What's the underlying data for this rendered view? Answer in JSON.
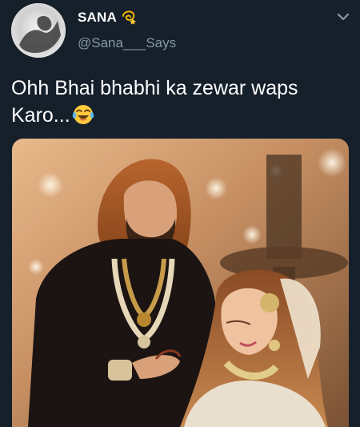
{
  "tweet": {
    "display_name": "SANA",
    "name_emoji_icon": "dizzy-star-icon",
    "handle": "@Sana___Says",
    "text_line_1": "Ohh Bhai bhabhi ka zewar waps",
    "text_line_2": "Karo...",
    "text_emoji_icon": "face-with-tears-of-joy-icon",
    "menu_icon": "chevron-down-icon"
  },
  "colors": {
    "background": "#15202b",
    "text_primary": "#ffffff",
    "text_secondary": "#8899a6"
  }
}
